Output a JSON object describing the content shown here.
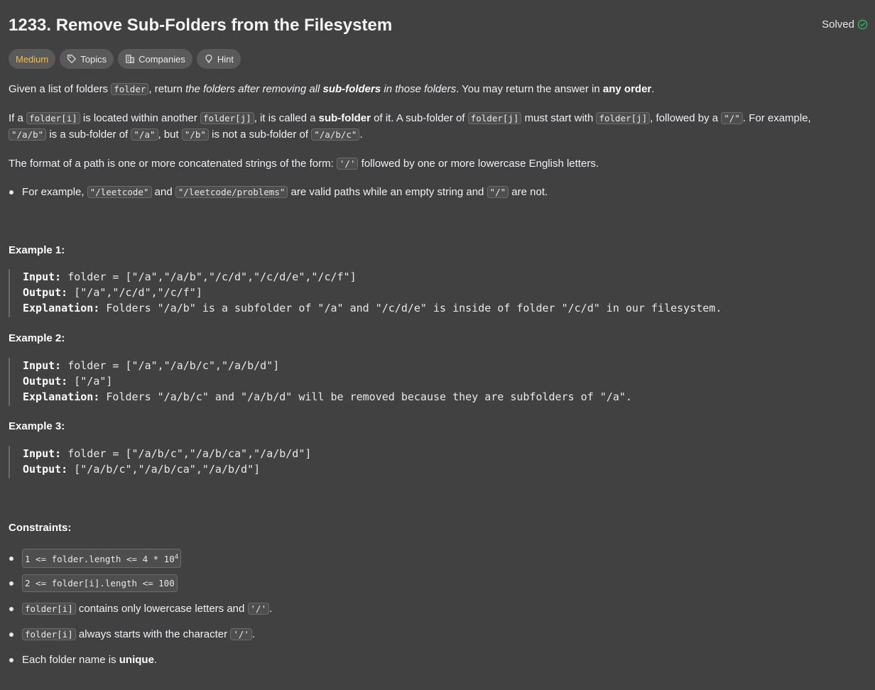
{
  "problem": {
    "title": "1233. Remove Sub-Folders from the Filesystem",
    "status": "Solved",
    "tags": {
      "difficulty": "Medium",
      "topics": "Topics",
      "companies": "Companies",
      "hint": "Hint"
    }
  },
  "description": {
    "p1": {
      "t1": "Given a list of folders ",
      "c1": "folder",
      "t2": ", return ",
      "i1": "the folders after removing all ",
      "b1": "sub-folders",
      "i2": " in those folders",
      "t3": ". You may return the answer in ",
      "b2": "any order",
      "t4": "."
    },
    "p2": {
      "t1": "If a ",
      "c1": "folder[i]",
      "t2": " is located within another ",
      "c2": "folder[j]",
      "t3": ", it is called a ",
      "b1": "sub-folder",
      "t4": " of it. A sub-folder of ",
      "c3": "folder[j]",
      "t5": " must start with ",
      "c4": "folder[j]",
      "t6": ", followed by a ",
      "c5": "\"/\"",
      "t7": ". For example,",
      "c6": "\"/a/b\"",
      "t8": " is a sub-folder of ",
      "c7": "\"/a\"",
      "t9": ", but ",
      "c8": "\"/b\"",
      "t10": " is not a sub-folder of ",
      "c9": "\"/a/b/c\"",
      "t11": "."
    },
    "p3": {
      "t1": "The format of a path is one or more concatenated strings of the form: ",
      "c1": "'/'",
      "t2": " followed by one or more lowercase English letters."
    },
    "bullet": {
      "t1": "For example, ",
      "c1": "\"/leetcode\"",
      "t2": " and ",
      "c2": "\"/leetcode/problems\"",
      "t3": " are valid paths while an empty string and ",
      "c3": "\"/\"",
      "t4": " are not."
    }
  },
  "examples": [
    {
      "heading": "Example 1:",
      "input_label": "Input:",
      "input": " folder = [\"/a\",\"/a/b\",\"/c/d\",\"/c/d/e\",\"/c/f\"]",
      "output_label": "Output:",
      "output": " [\"/a\",\"/c/d\",\"/c/f\"]",
      "expl_label": "Explanation:",
      "expl": " Folders \"/a/b\" is a subfolder of \"/a\" and \"/c/d/e\" is inside of folder \"/c/d\" in our filesystem."
    },
    {
      "heading": "Example 2:",
      "input_label": "Input:",
      "input": " folder = [\"/a\",\"/a/b/c\",\"/a/b/d\"]",
      "output_label": "Output:",
      "output": " [\"/a\"]",
      "expl_label": "Explanation:",
      "expl": " Folders \"/a/b/c\" and \"/a/b/d\" will be removed because they are subfolders of \"/a\"."
    },
    {
      "heading": "Example 3:",
      "input_label": "Input:",
      "input": " folder = [\"/a/b/c\",\"/a/b/ca\",\"/a/b/d\"]",
      "output_label": "Output:",
      "output": " [\"/a/b/c\",\"/a/b/ca\",\"/a/b/d\"]"
    }
  ],
  "constraints": {
    "heading": "Constraints:",
    "c1": "1 <= folder.length <= 4 * 10",
    "c1_sup": "4",
    "c2": "2 <= folder[i].length <= 100",
    "c3_code": "folder[i]",
    "c3_text": " contains only lowercase letters and ",
    "c3_code2": "'/'",
    "c3_end": ".",
    "c4_code": "folder[i]",
    "c4_text": " always starts with the character ",
    "c4_code2": "'/'",
    "c4_end": ".",
    "c5_text": "Each folder name is ",
    "c5_bold": "unique",
    "c5_end": "."
  },
  "colors": {
    "background": "#414141",
    "difficulty_medium": "#ffc01e",
    "solved_check": "#2cbb5d"
  }
}
